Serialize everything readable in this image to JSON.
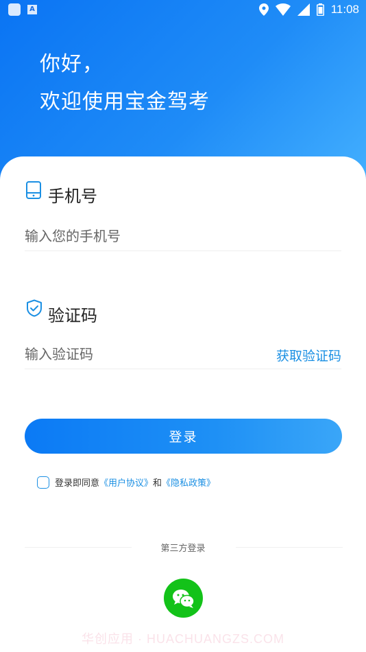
{
  "status_bar": {
    "time": "11:08",
    "app_icon_letter": "A"
  },
  "hero": {
    "greeting": "你好，",
    "welcome": "欢迎使用宝金驾考"
  },
  "phone": {
    "label": "手机号",
    "placeholder": "输入您的手机号",
    "value": ""
  },
  "code": {
    "label": "验证码",
    "placeholder": "输入验证码",
    "value": "",
    "get_code": "获取验证码"
  },
  "login": {
    "button_label": "登录"
  },
  "agreement": {
    "checked": false,
    "prefix": "登录即同意",
    "user_agreement": "《用户协议》",
    "and": "和",
    "privacy_policy": "《隐私政策》"
  },
  "third_party": {
    "label": "第三方登录",
    "providers": [
      "wechat-icon"
    ]
  },
  "watermark": "华创应用 · HUACHUANGZS.COM",
  "colors": {
    "brand_blue": "#0a74f3",
    "link_blue": "#1a8fe3",
    "wechat_green": "#13c219"
  }
}
